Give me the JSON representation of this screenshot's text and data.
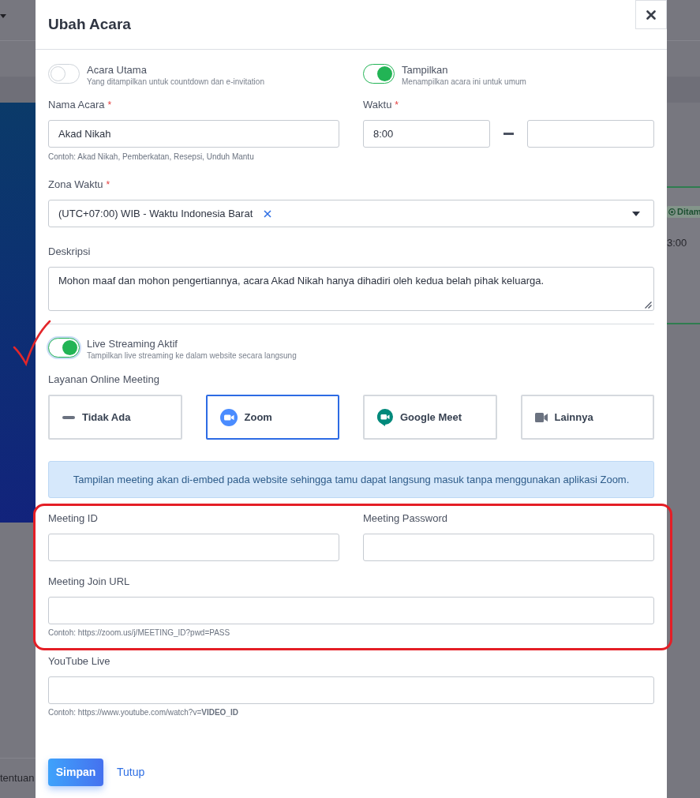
{
  "background": {
    "badge": "Ditam",
    "time": "3:00",
    "footer_text": "tentuan"
  },
  "modal": {
    "title": "Ubah Acara"
  },
  "toggles": [
    {
      "label": "Acara Utama",
      "description": "Yang ditampilkan untuk countdown dan e-invitation",
      "on": false
    },
    {
      "label": "Tampilkan",
      "description": "Menampilkan acara ini untuk umum",
      "on": true
    }
  ],
  "event_name": {
    "label": "Nama Acara",
    "required_mark": "*",
    "value": "Akad Nikah",
    "hint": "Contoh: Akad Nikah, Pemberkatan, Resepsi, Unduh Mantu"
  },
  "time": {
    "label": "Waktu",
    "required_mark": "*",
    "start": "8:00"
  },
  "timezone": {
    "label": "Zona Waktu",
    "required_mark": "*",
    "value": "(UTC+07:00) WIB - Waktu Indonesia Barat"
  },
  "description": {
    "label": "Deskripsi",
    "value": "Mohon maaf dan mohon pengertiannya, acara Akad Nikah hanya dihadiri oleh kedua belah pihak keluarga."
  },
  "live_streaming": {
    "label": "Live Streaming Aktif",
    "description": "Tampilkan live streaming ke dalam website secara langsung",
    "on": true,
    "focused": true
  },
  "online_meeting": {
    "label": "Layanan Online Meeting",
    "services": [
      {
        "kind": "none",
        "label": "Tidak Ada",
        "selected": false
      },
      {
        "kind": "zoom",
        "label": "Zoom",
        "selected": true
      },
      {
        "kind": "google_meet",
        "label": "Google Meet",
        "selected": false
      },
      {
        "kind": "other",
        "label": "Lainnya",
        "selected": false
      }
    ]
  },
  "notice": "Tampilan meeting akan di-embed pada website sehingga tamu dapat langsung masuk tanpa menggunakan aplikasi Zoom.",
  "meeting": {
    "fields": [
      {
        "label": "Meeting ID"
      },
      {
        "label": "Meeting Password"
      }
    ],
    "join_url": {
      "label": "Meeting Join URL",
      "hint": "Contoh: https://zoom.us/j/MEETING_ID?pwd=PASS"
    }
  },
  "youtube": {
    "label": "YouTube Live",
    "hint": "Contoh: https://www.youtube.com/watch?v=**VIDEO_ID**"
  },
  "buttons": [
    {
      "kind": "primary",
      "label": "Simpan"
    },
    {
      "kind": "link",
      "label": "Tutup"
    }
  ]
}
